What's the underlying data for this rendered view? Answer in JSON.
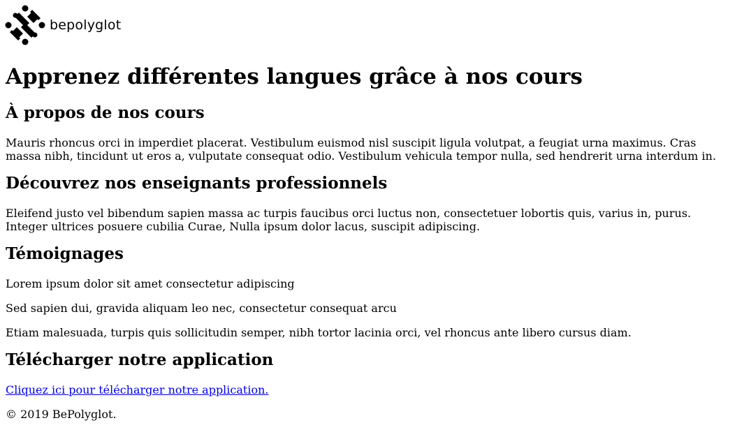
{
  "brand": {
    "logo_text": "bepolyglot",
    "logo_icon": "people-circle-logo-icon"
  },
  "main": {
    "title": "Apprenez différentes langues grâce à nos cours",
    "sections": {
      "about": {
        "heading": "À propos de nos cours",
        "text": "Mauris rhoncus orci in imperdiet placerat. Vestibulum euismod nisl suscipit ligula volutpat, a feugiat urna maximus. Cras massa nibh, tincidunt ut eros a, vulputate consequat odio. Vestibulum vehicula tempor nulla, sed hendrerit urna interdum in."
      },
      "teachers": {
        "heading": "Découvrez nos enseignants professionnels",
        "text": "Eleifend justo vel bibendum sapien massa ac turpis faucibus orci luctus non, consectetuer lobortis quis, varius in, purus. Integer ultrices posuere cubilia Curae, Nulla ipsum dolor lacus, suscipit adipiscing."
      },
      "testimonials": {
        "heading": "Témoignages",
        "items": [
          "Lorem ipsum dolor sit amet consectetur adipiscing",
          "Sed sapien dui, gravida aliquam leo nec, consectetur consequat arcu",
          "Etiam malesuada, turpis quis sollicitudin semper, nibh tortor lacinia orci, vel rhoncus ante libero cursus diam."
        ]
      },
      "download": {
        "heading": "Télécharger notre application",
        "link_text": "Cliquez ici pour télécharger notre application."
      }
    }
  },
  "footer": {
    "copyright": "© 2019 BePolyglot."
  },
  "colors": {
    "link": "#0000ee",
    "text": "#000000",
    "background": "#ffffff"
  }
}
